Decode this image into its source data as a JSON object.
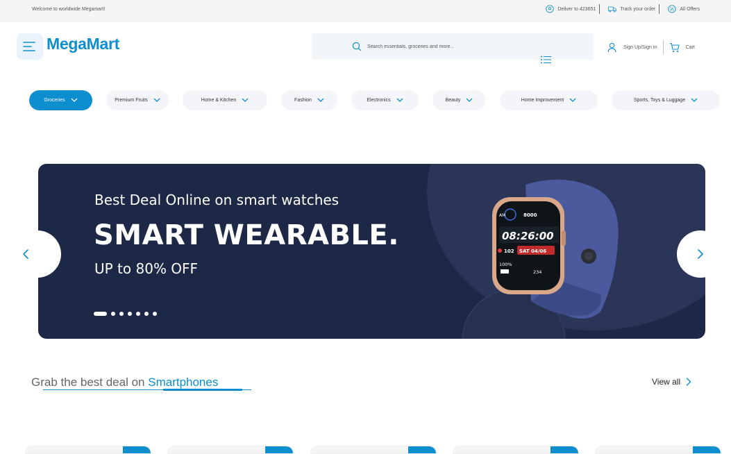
{
  "topbar": {
    "welcome": "Welcome to worldwide Megamart!",
    "deliver": "Deliver to 423651",
    "track": "Track your order",
    "offers": "All Offers"
  },
  "header": {
    "logo": "MegaMart",
    "search_placeholder": "Search essentials, groceries and more...",
    "signin": "Sign Up/Sign In",
    "cart": "Cart"
  },
  "categories": [
    {
      "label": "Groceries",
      "active": true
    },
    {
      "label": "Premium Fruits",
      "active": false
    },
    {
      "label": "Home & Kitchen",
      "active": false
    },
    {
      "label": "Fashion",
      "active": false
    },
    {
      "label": "Electronics",
      "active": false
    },
    {
      "label": "Beauty",
      "active": false
    },
    {
      "label": "Home Improvement",
      "active": false
    },
    {
      "label": "Sports, Toys & Luggage",
      "active": false
    }
  ],
  "banner": {
    "kicker": "Best Deal Online on smart watches",
    "headline": "SMART WEARABLE.",
    "offer": "UP to 80% OFF",
    "slide_count": 7,
    "active_slide": 1,
    "watch": {
      "time": "08:26:00",
      "steps": "8000",
      "hr": "102",
      "date": "SAT 04/06",
      "battery": "100%",
      "kcal": "234"
    }
  },
  "deals": {
    "title_prefix": "Grab the best deal on ",
    "title_highlight": "Smartphones",
    "view_all": "View all"
  },
  "colors": {
    "brand": "#0d8ecf",
    "banner_bg": "#1d2846",
    "pill_bg": "#f3f5f8"
  },
  "icons": {
    "menu": "hamburger-icon",
    "search": "search-icon",
    "location": "location-pin-icon",
    "truck": "truck-icon",
    "offers": "discount-icon",
    "user": "user-icon",
    "cart": "cart-icon",
    "list": "list-icon",
    "chevron": "chevron-down-icon"
  }
}
